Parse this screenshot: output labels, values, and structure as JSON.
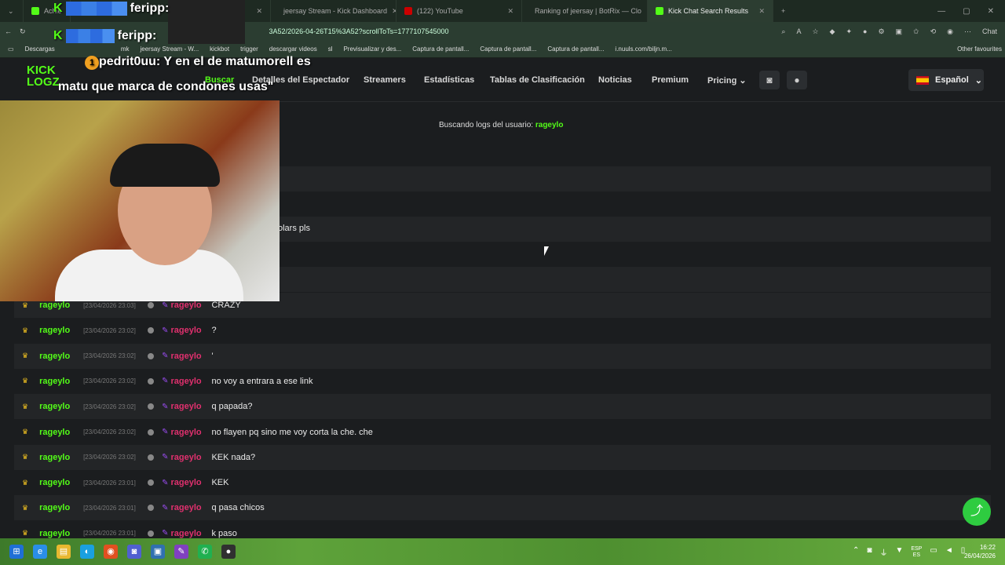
{
  "browser": {
    "tabs": [
      {
        "label": "Achie",
        "color": "#53fc18"
      },
      {
        "label": "",
        "color": "#53fc18"
      },
      {
        "label": "jeersay Stream - Kick Dashboard",
        "color": "#53fc18"
      },
      {
        "label": "(122) YouTube",
        "color": "#ff0000"
      },
      {
        "label": "Ranking of jeersay | BotRix — Clo",
        "color": "#888888"
      },
      {
        "label": "Kick Chat Search Results",
        "color": "#53fc18"
      }
    ],
    "url_fragment": "3A52/2026-04-26T15%3A52?scrollToTs=1777107545000",
    "bookmarks": [
      "Descargas",
      "mk",
      "jeersay Stream - W...",
      "kickbot",
      "trigger",
      "descargar videos",
      "sl",
      "Previsualizar y des...",
      "Captura de pantall...",
      "Captura de pantall...",
      "Captura de pantall...",
      "i.nuuls.com/biljn.m...",
      "Other favourites"
    ],
    "user_link_label": "Chat"
  },
  "site": {
    "logo_line1": "KICK",
    "logo_line2": "LOGZ",
    "nav": [
      "Buscar",
      "Detalles del Espectador",
      "Streamers",
      "Estadísticas",
      "Tablas de Clasificación",
      "Noticias",
      "Premium",
      "Pricing ⌄"
    ],
    "language": "Español",
    "searching_label": "Buscando logs del usuario:",
    "searching_user": "rageylo"
  },
  "partial_message": "olars pls",
  "messages": [
    {
      "user": "rageylo",
      "time": "[23/04/2026 23:03]",
      "channel": "rageylo",
      "text": "CRAZY"
    },
    {
      "user": "rageylo",
      "time": "[23/04/2026 23:02]",
      "channel": "rageylo",
      "text": "?"
    },
    {
      "user": "rageylo",
      "time": "[23/04/2026 23:02]",
      "channel": "rageylo",
      "text": "'"
    },
    {
      "user": "rageylo",
      "time": "[23/04/2026 23:02]",
      "channel": "rageylo",
      "text": "no voy a entrara a ese link"
    },
    {
      "user": "rageylo",
      "time": "[23/04/2026 23:02]",
      "channel": "rageylo",
      "text": "q papada?"
    },
    {
      "user": "rageylo",
      "time": "[23/04/2026 23:02]",
      "channel": "rageylo",
      "text": "no flayen pq sino me voy corta la che. che"
    },
    {
      "user": "rageylo",
      "time": "[23/04/2026 23:02]",
      "channel": "rageylo",
      "text": "KEK nada?"
    },
    {
      "user": "rageylo",
      "time": "[23/04/2026 23:01]",
      "channel": "rageylo",
      "text": "KEK"
    },
    {
      "user": "rageylo",
      "time": "[23/04/2026 23:01]",
      "channel": "rageylo",
      "text": "q pasa chicos"
    },
    {
      "user": "rageylo",
      "time": "[23/04/2026 23:01]",
      "channel": "rageylo",
      "text": "k paso"
    }
  ],
  "overlay": {
    "line1": "ferіpp:",
    "line2": "ferіpp:",
    "chat_badge": "1",
    "chat_user": "pedrit0uu:",
    "chat_text1": " Y en el de matumorell es",
    "chat_text2": "matu que marca de condones usas\""
  },
  "taskbar": {
    "lang": "ESP",
    "lang2": "ES",
    "time": "16:22",
    "date": "26/04/2026"
  }
}
